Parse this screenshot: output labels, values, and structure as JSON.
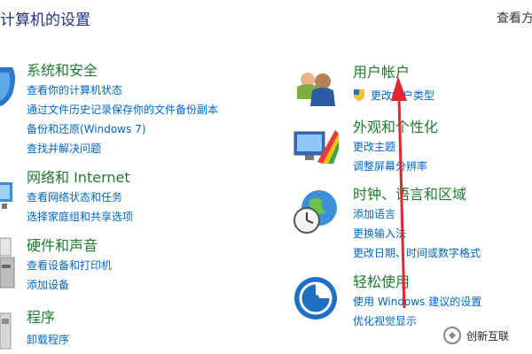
{
  "header": {
    "title": "计算机的设置",
    "view_by": "查看方"
  },
  "left": [
    {
      "title": "系统和安全",
      "links": [
        "查看你的计算机状态",
        "通过文件历史记录保存你的文件备份副本",
        "备份和还原(Windows 7)",
        "查找并解决问题"
      ]
    },
    {
      "title": "网络和 Internet",
      "links": [
        "查看网络状态和任务",
        "选择家庭组和共享选项"
      ]
    },
    {
      "title": "硬件和声音",
      "links": [
        "查看设备和打印机",
        "添加设备"
      ]
    },
    {
      "title": "程序",
      "links": [
        "卸载程序"
      ]
    }
  ],
  "right": [
    {
      "title": "用户帐户",
      "links": [
        "更改帐户类型"
      ]
    },
    {
      "title": "外观和个性化",
      "links": [
        "更改主题",
        "调整屏幕分辨率"
      ]
    },
    {
      "title": "时钟、语言和区域",
      "links": [
        "添加语言",
        "更换输入法",
        "更改日期、时间或数字格式"
      ]
    },
    {
      "title": "轻松使用",
      "links": [
        "使用 Windows 建议的设置",
        "优化视觉显示"
      ]
    }
  ],
  "watermark": {
    "text": "创新互联"
  },
  "colors": {
    "category": "#1e7a2e",
    "link": "#0066cc",
    "title": "#1e3287",
    "annotation_arrow": "#e0282e"
  }
}
